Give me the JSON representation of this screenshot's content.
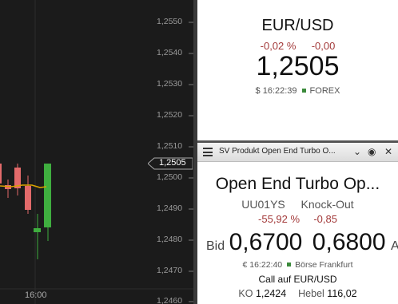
{
  "chart": {
    "y_ticks": [
      "1,2550",
      "1,2540",
      "1,2530",
      "1,2520",
      "1,2510",
      "1,2500",
      "1,2490",
      "1,2480",
      "1,2470",
      "1,2460"
    ],
    "current_price": "1,2505",
    "time_label": "16:00",
    "colors": {
      "up": "#3fae3f",
      "down": "#e36a6a",
      "ma": "#d9a200"
    }
  },
  "quote": {
    "pair": "EUR/USD",
    "change_pct": "-0,02 %",
    "change_abs": "-0,00",
    "price": "1,2505",
    "timestamp": "$ 16:22:39",
    "exchange": "FOREX"
  },
  "product": {
    "window_title": "SV Produkt Open End Turbo O...",
    "name": "Open End Turbo Op...",
    "wkn": "UU01YS",
    "type": "Knock-Out",
    "change_pct": "-55,92 %",
    "change_abs": "-0,85",
    "bid_label": "Bid",
    "bid": "0,6700",
    "ask": "0,6800",
    "ask_label": "A",
    "timestamp": "€ 16:22:40",
    "exchange": "Börse Frankfurt",
    "description": "Call auf EUR/USD",
    "ko_label": "KO",
    "ko_value": "1,2424",
    "leverage_label": "Hebel",
    "leverage_value": "116,02"
  }
}
